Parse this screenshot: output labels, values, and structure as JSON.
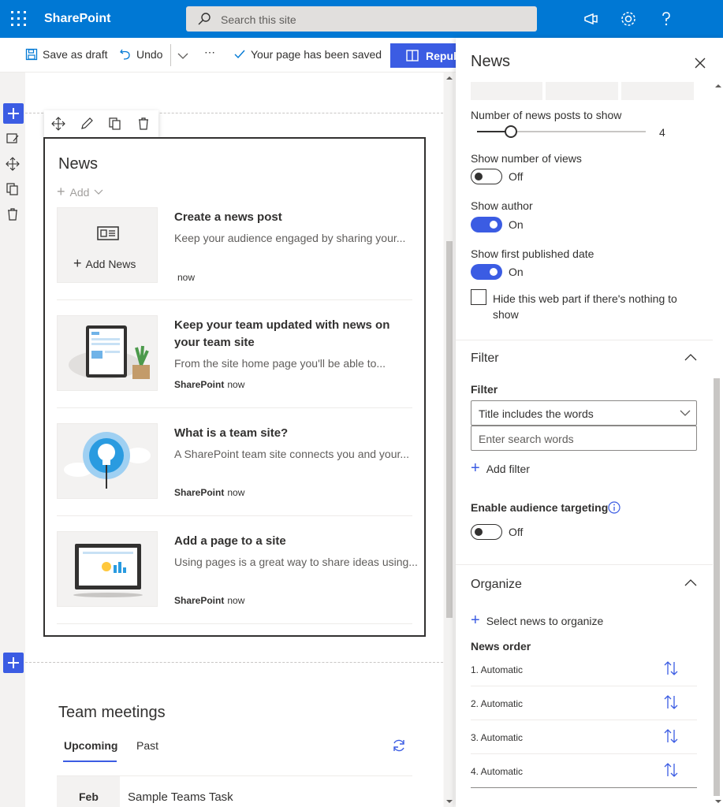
{
  "topbar": {
    "app_name": "SharePoint",
    "search_placeholder": "Search this site"
  },
  "cmdbar": {
    "save_draft": "Save as draft",
    "undo": "Undo",
    "more": "⋯",
    "saved_status": "Your page has been saved",
    "republish": "Repub"
  },
  "news": {
    "title": "News",
    "add": "Add",
    "add_news": "Add News",
    "items": [
      {
        "title": "Create a news post",
        "desc": "Keep your audience engaged by sharing your...",
        "author": "",
        "time": "now"
      },
      {
        "title": "Keep your team updated with news on your team site",
        "desc": "From the site home page you'll be able to...",
        "author": "SharePoint",
        "time": "now"
      },
      {
        "title": "What is a team site?",
        "desc": "A SharePoint team site connects you and your...",
        "author": "SharePoint",
        "time": "now"
      },
      {
        "title": "Add a page to a site",
        "desc": "Using pages is a great way to share ideas using...",
        "author": "SharePoint",
        "time": "now"
      }
    ]
  },
  "team": {
    "title": "Team meetings",
    "tabs": [
      "Upcoming",
      "Past"
    ],
    "month": "Feb",
    "task": "Sample Teams Task"
  },
  "panel": {
    "title": "News",
    "num_posts_label": "Number of news posts to show",
    "num_posts_value": "4",
    "show_views": {
      "label": "Show number of views",
      "state": "Off"
    },
    "show_author": {
      "label": "Show author",
      "state": "On"
    },
    "show_date": {
      "label": "Show first published date",
      "state": "On"
    },
    "hide_label": "Hide this web part if there's nothing to show",
    "filter": {
      "section": "Filter",
      "label": "Filter",
      "select_value": "Title includes the words",
      "input_placeholder": "Enter search words",
      "add_filter": "Add filter"
    },
    "audience": {
      "label": "Enable audience targeting",
      "state": "Off"
    },
    "organize": {
      "section": "Organize",
      "select": "Select news to organize",
      "order_label": "News order",
      "rows": [
        "1.  Automatic",
        "2.  Automatic",
        "3.  Automatic",
        "4.  Automatic"
      ]
    }
  },
  "colors": {
    "brand": "#0078d4",
    "accent": "#3b5ce3"
  }
}
